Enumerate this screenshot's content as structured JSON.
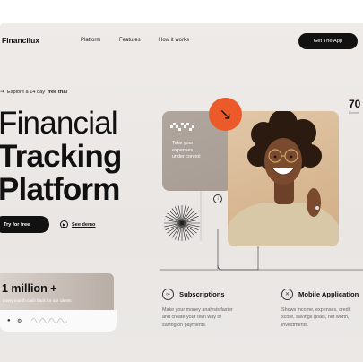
{
  "brand": {
    "name": "Financilux"
  },
  "nav": {
    "platform": "Platform",
    "features": "Features",
    "how": "How it works"
  },
  "cta_app": "Get The App",
  "trial": {
    "prefix": "Explore a 14 day",
    "bold": "free trial"
  },
  "headline": {
    "line1": "Financial",
    "line2": "Tracking",
    "line3": "Platform"
  },
  "cta_try": "Try for free",
  "cta_demo": "See demo",
  "million": {
    "value": "1 million +",
    "caption": "Every month cash back for our clients"
  },
  "card_text": {
    "line1": "Take your",
    "line2": "expenses",
    "line3": "under control"
  },
  "stat": {
    "value": "70",
    "sub": "Downl"
  },
  "features": {
    "f1": {
      "title": "Subscriptions",
      "desc1": "Make your money analysis faster",
      "desc2": "and create your own way of",
      "desc3": "saving on payments."
    },
    "f2": {
      "title": "Mobile Application",
      "desc1": "Shows income, expenses, credit",
      "desc2": "score, savings goals, net worth,",
      "desc3": "investments."
    }
  },
  "icons": {
    "trial": "arrow-right-icon",
    "play": "play-icon",
    "orange": "arrow-down-right-icon",
    "sunburst": "sunburst-icon",
    "down": "arrow-down-icon",
    "sub": "link-icon",
    "mobile": "x-icon"
  },
  "colors": {
    "accent": "#ed5a2a",
    "dark": "#111111",
    "background": "#ebe8e5"
  }
}
